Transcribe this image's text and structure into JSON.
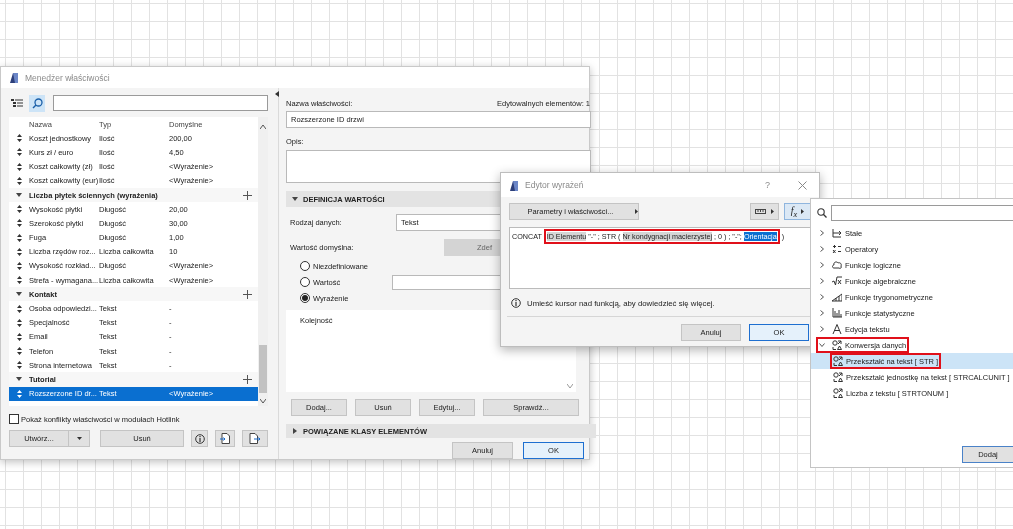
{
  "properties_manager": {
    "title": "Menedżer właściwości",
    "columns": [
      "Nazwa",
      "Typ",
      "Domyślne"
    ],
    "rows": [
      {
        "kind": "property",
        "name": "Koszt jednostkowy",
        "type": "Ilość",
        "default": "200,00",
        "selected": false
      },
      {
        "kind": "property",
        "name": "Kurs zł / euro",
        "type": "Ilość",
        "default": "4,50",
        "selected": false
      },
      {
        "kind": "property",
        "name": "Koszt całkowity (zł)",
        "type": "Ilość",
        "default": "<Wyrażenie>",
        "selected": false
      },
      {
        "kind": "property",
        "name": "Koszt całkowity (eur)",
        "type": "Ilość",
        "default": "<Wyrażenie>",
        "selected": false
      },
      {
        "kind": "group",
        "name": "Liczba płytek ściennych (wyrażenia)",
        "expanded": true,
        "children": [
          {
            "kind": "property",
            "name": "Wysokość płytki",
            "type": "Długość",
            "default": "20,00",
            "selected": false
          },
          {
            "kind": "property",
            "name": "Szerokość płytki",
            "type": "Długość",
            "default": "30,00",
            "selected": false
          },
          {
            "kind": "property",
            "name": "Fuga",
            "type": "Długość",
            "default": "1,00",
            "selected": false
          },
          {
            "kind": "property",
            "name": "Liczba rzędów roz...",
            "type": "Liczba całkowita",
            "default": "10",
            "selected": false
          },
          {
            "kind": "property",
            "name": "Wysokość rozkład...",
            "type": "Długość",
            "default": "<Wyrażenie>",
            "selected": false
          },
          {
            "kind": "property",
            "name": "Strefa - wymagana...",
            "type": "Liczba całkowita",
            "default": "<Wyrażenie>",
            "selected": false
          }
        ]
      },
      {
        "kind": "group",
        "name": "Kontakt",
        "expanded": true,
        "children": [
          {
            "kind": "property",
            "name": "Osoba odpowiedzi...",
            "type": "Tekst",
            "default": "-",
            "selected": false
          },
          {
            "kind": "property",
            "name": "Specjalność",
            "type": "Tekst",
            "default": "-",
            "selected": false
          },
          {
            "kind": "property",
            "name": "Email",
            "type": "Tekst",
            "default": "-",
            "selected": false
          },
          {
            "kind": "property",
            "name": "Telefon",
            "type": "Tekst",
            "default": "-",
            "selected": false
          },
          {
            "kind": "property",
            "name": "Strona internetowa",
            "type": "Tekst",
            "default": "-",
            "selected": false
          }
        ]
      },
      {
        "kind": "group",
        "name": "Tutorial",
        "expanded": true,
        "children": [
          {
            "kind": "property",
            "name": "Rozszerzone ID dr...",
            "type": "Tekst",
            "default": "<Wyrażenie>",
            "selected": true
          }
        ]
      }
    ],
    "hotlink_checkbox": {
      "label": "Pokaż konflikty właściwości w modułach Hotlink",
      "checked": false
    },
    "create_button": "Utwórz...",
    "delete_button": "Usuń",
    "name_label": "Nazwa właściwości:",
    "editable_count": "Edytowalnych elementów: 1",
    "name_value": "Rozszerzone ID drzwi",
    "description_label": "Opis:",
    "value_definition": {
      "title": "DEFINICJA WARTOŚCI",
      "expanded": true,
      "data_type_label": "Rodzaj danych:",
      "data_type": "Tekst",
      "default_label": "Wartość domyślna:",
      "define_button": "Zdef",
      "options": [
        {
          "label": "Niezdefiniowane",
          "selected": false
        },
        {
          "label": "Wartość",
          "selected": false
        },
        {
          "label": "Wyrażenie",
          "selected": true
        }
      ],
      "list_header": "Kolejność",
      "buttons": [
        "Dodaj...",
        "Usuń",
        "Edytuj...",
        "Sprawdź..."
      ]
    },
    "related_section": {
      "title": "POWIĄZANE KLASY ELEMENTÓW",
      "expanded": false
    },
    "dialog_buttons": [
      "Anuluj",
      "OK"
    ]
  },
  "expression_editor": {
    "title": "Edytor wyrażeń",
    "help": "?",
    "parameters_button": "Parametry i właściwości...",
    "function_button": "f$_{x}$",
    "expression": [
      {
        "kind": "text",
        "text": "CONCAT"
      },
      {
        "kind": "group",
        "annotated": true,
        "children": [
          {
            "kind": "parameter",
            "text": "ID Elementu",
            "selected": false
          },
          {
            "kind": "text",
            "text": "\"-\" ; STR ("
          },
          {
            "kind": "parameter",
            "text": "Nr kondygnacji macierzystej",
            "selected": false
          },
          {
            "kind": "text",
            "text": "; 0 ) ; \"-\";"
          },
          {
            "kind": "parameter",
            "text": "Orientacja",
            "selected": true
          }
        ]
      },
      {
        "kind": "text",
        "text": ")"
      }
    ],
    "info": "Umieść kursor nad funkcją, aby dowiedzieć się więcej.",
    "buttons": [
      "Anuluj",
      "OK"
    ]
  },
  "function_panel": {
    "items": [
      {
        "label": "Stałe",
        "expanded": false,
        "annotated": false
      },
      {
        "label": "Operatory",
        "expanded": false,
        "annotated": false
      },
      {
        "label": "Funkcje logiczne",
        "expanded": false,
        "annotated": false
      },
      {
        "label": "Funkcje algebraiczne",
        "expanded": false,
        "annotated": false
      },
      {
        "label": "Funkcje trygonometryczne",
        "expanded": false,
        "annotated": false
      },
      {
        "label": "Funkcje statystyczne",
        "expanded": false,
        "annotated": false
      },
      {
        "label": "Edycja tekstu",
        "expanded": false,
        "annotated": false
      },
      {
        "label": "Konwersja danych",
        "expanded": true,
        "annotated": true,
        "children": [
          {
            "label": "Przekształć na tekst [ STR ]",
            "selected": true,
            "annotated": true
          },
          {
            "label": "Przekształć jednostkę na tekst [ STRCALCUNIT ]",
            "selected": false,
            "annotated": false
          },
          {
            "label": "Liczba z tekstu [ STRTONUM ]",
            "selected": false,
            "annotated": false
          }
        ]
      }
    ],
    "add_button": "Dodaj"
  }
}
